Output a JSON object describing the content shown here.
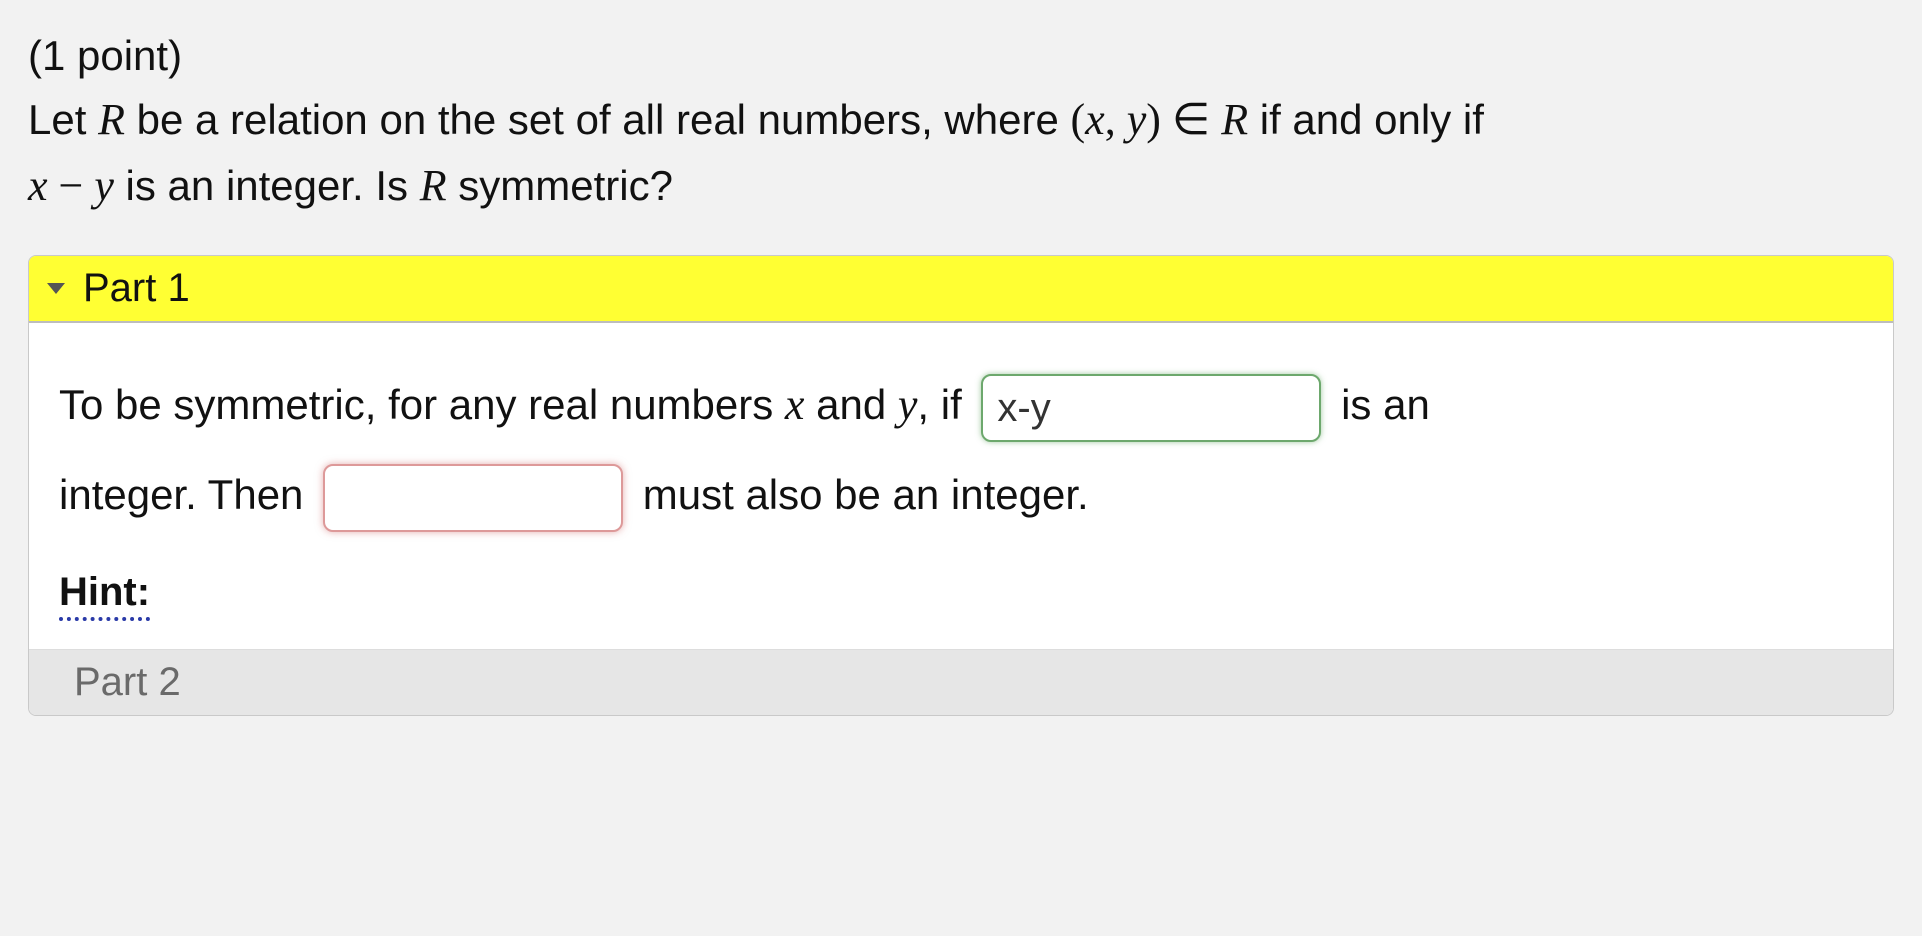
{
  "question": {
    "points_label": "(1 point)",
    "line1_a": "Let ",
    "R": "R",
    "line1_b": " be a relation on the set of all real numbers, where ",
    "pair_open": "(",
    "x": "x",
    "comma": ", ",
    "y": "y",
    "pair_close": ")",
    "elem": " ∈ ",
    "line1_c": " if and only if",
    "line2_a": " is an integer. Is ",
    "minus": " − ",
    "line2_b": " symmetric?"
  },
  "part1": {
    "title": "Part 1",
    "t1": "To be symmetric, for any real numbers ",
    "and": " and ",
    "t2": ", if ",
    "input1_value": "x-y",
    "t3": " is an",
    "t4": "integer. Then ",
    "input2_value": "",
    "t5": " must also be an integer.",
    "hint_label": "Hint:"
  },
  "part2": {
    "title": "Part 2"
  }
}
